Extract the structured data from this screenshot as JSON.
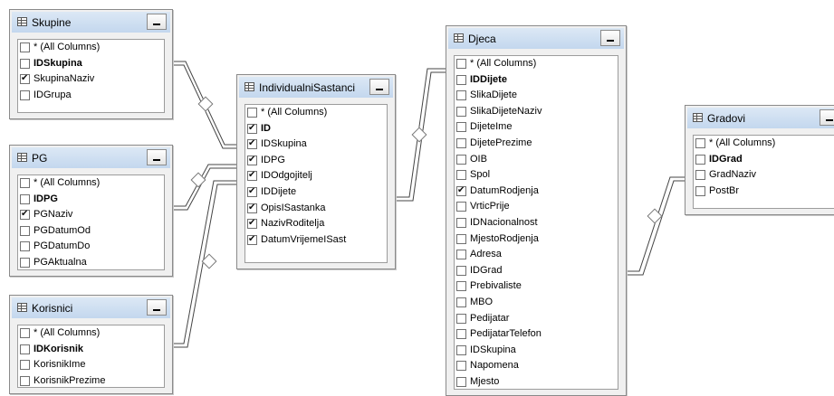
{
  "tables": {
    "skupine": {
      "title": "Skupine",
      "columns": [
        {
          "label": "* (All Columns)",
          "checked": false,
          "pk": false
        },
        {
          "label": "IDSkupina",
          "checked": false,
          "pk": true
        },
        {
          "label": "SkupinaNaziv",
          "checked": true,
          "pk": false
        },
        {
          "label": "IDGrupa",
          "checked": false,
          "pk": false
        }
      ]
    },
    "pg": {
      "title": "PG",
      "columns": [
        {
          "label": "* (All Columns)",
          "checked": false,
          "pk": false
        },
        {
          "label": "IDPG",
          "checked": false,
          "pk": true
        },
        {
          "label": "PGNaziv",
          "checked": true,
          "pk": false
        },
        {
          "label": "PGDatumOd",
          "checked": false,
          "pk": false
        },
        {
          "label": "PGDatumDo",
          "checked": false,
          "pk": false
        },
        {
          "label": "PGAktualna",
          "checked": false,
          "pk": false
        }
      ]
    },
    "korisnici": {
      "title": "Korisnici",
      "columns": [
        {
          "label": "* (All Columns)",
          "checked": false,
          "pk": false
        },
        {
          "label": "IDKorisnik",
          "checked": false,
          "pk": true
        },
        {
          "label": "KorisnikIme",
          "checked": false,
          "pk": false
        },
        {
          "label": "KorisnikPrezime",
          "checked": false,
          "pk": false
        }
      ]
    },
    "individualni": {
      "title": "IndividualniSastanci",
      "columns": [
        {
          "label": "* (All Columns)",
          "checked": false,
          "pk": false
        },
        {
          "label": "ID",
          "checked": true,
          "pk": true
        },
        {
          "label": "IDSkupina",
          "checked": true,
          "pk": false
        },
        {
          "label": "IDPG",
          "checked": true,
          "pk": false
        },
        {
          "label": "IDOdgojitelj",
          "checked": true,
          "pk": false
        },
        {
          "label": "IDDijete",
          "checked": true,
          "pk": false
        },
        {
          "label": "OpisISastanka",
          "checked": true,
          "pk": false
        },
        {
          "label": "NazivRoditelja",
          "checked": true,
          "pk": false
        },
        {
          "label": "DatumVrijemeISast",
          "checked": true,
          "pk": false
        }
      ]
    },
    "djeca": {
      "title": "Djeca",
      "columns": [
        {
          "label": "* (All Columns)",
          "checked": false,
          "pk": false
        },
        {
          "label": "IDDijete",
          "checked": false,
          "pk": true
        },
        {
          "label": "SlikaDijete",
          "checked": false,
          "pk": false
        },
        {
          "label": "SlikaDijeteNaziv",
          "checked": false,
          "pk": false
        },
        {
          "label": "DijeteIme",
          "checked": false,
          "pk": false
        },
        {
          "label": "DijetePrezime",
          "checked": false,
          "pk": false
        },
        {
          "label": "OIB",
          "checked": false,
          "pk": false
        },
        {
          "label": "Spol",
          "checked": false,
          "pk": false
        },
        {
          "label": "DatumRodjenja",
          "checked": true,
          "pk": false
        },
        {
          "label": "VrticPrije",
          "checked": false,
          "pk": false
        },
        {
          "label": "IDNacionalnost",
          "checked": false,
          "pk": false
        },
        {
          "label": "MjestoRodjenja",
          "checked": false,
          "pk": false
        },
        {
          "label": "Adresa",
          "checked": false,
          "pk": false
        },
        {
          "label": "IDGrad",
          "checked": false,
          "pk": false
        },
        {
          "label": "Prebivaliste",
          "checked": false,
          "pk": false
        },
        {
          "label": "MBO",
          "checked": false,
          "pk": false
        },
        {
          "label": "Pedijatar",
          "checked": false,
          "pk": false
        },
        {
          "label": "PedijatarTelefon",
          "checked": false,
          "pk": false
        },
        {
          "label": "IDSkupina",
          "checked": false,
          "pk": false
        },
        {
          "label": "Napomena",
          "checked": false,
          "pk": false
        },
        {
          "label": "Mjesto",
          "checked": false,
          "pk": false
        }
      ]
    },
    "gradovi": {
      "title": "Gradovi",
      "columns": [
        {
          "label": "* (All Columns)",
          "checked": false,
          "pk": false
        },
        {
          "label": "IDGrad",
          "checked": false,
          "pk": true
        },
        {
          "label": "GradNaziv",
          "checked": false,
          "pk": false
        },
        {
          "label": "PostBr",
          "checked": false,
          "pk": false
        }
      ]
    }
  }
}
